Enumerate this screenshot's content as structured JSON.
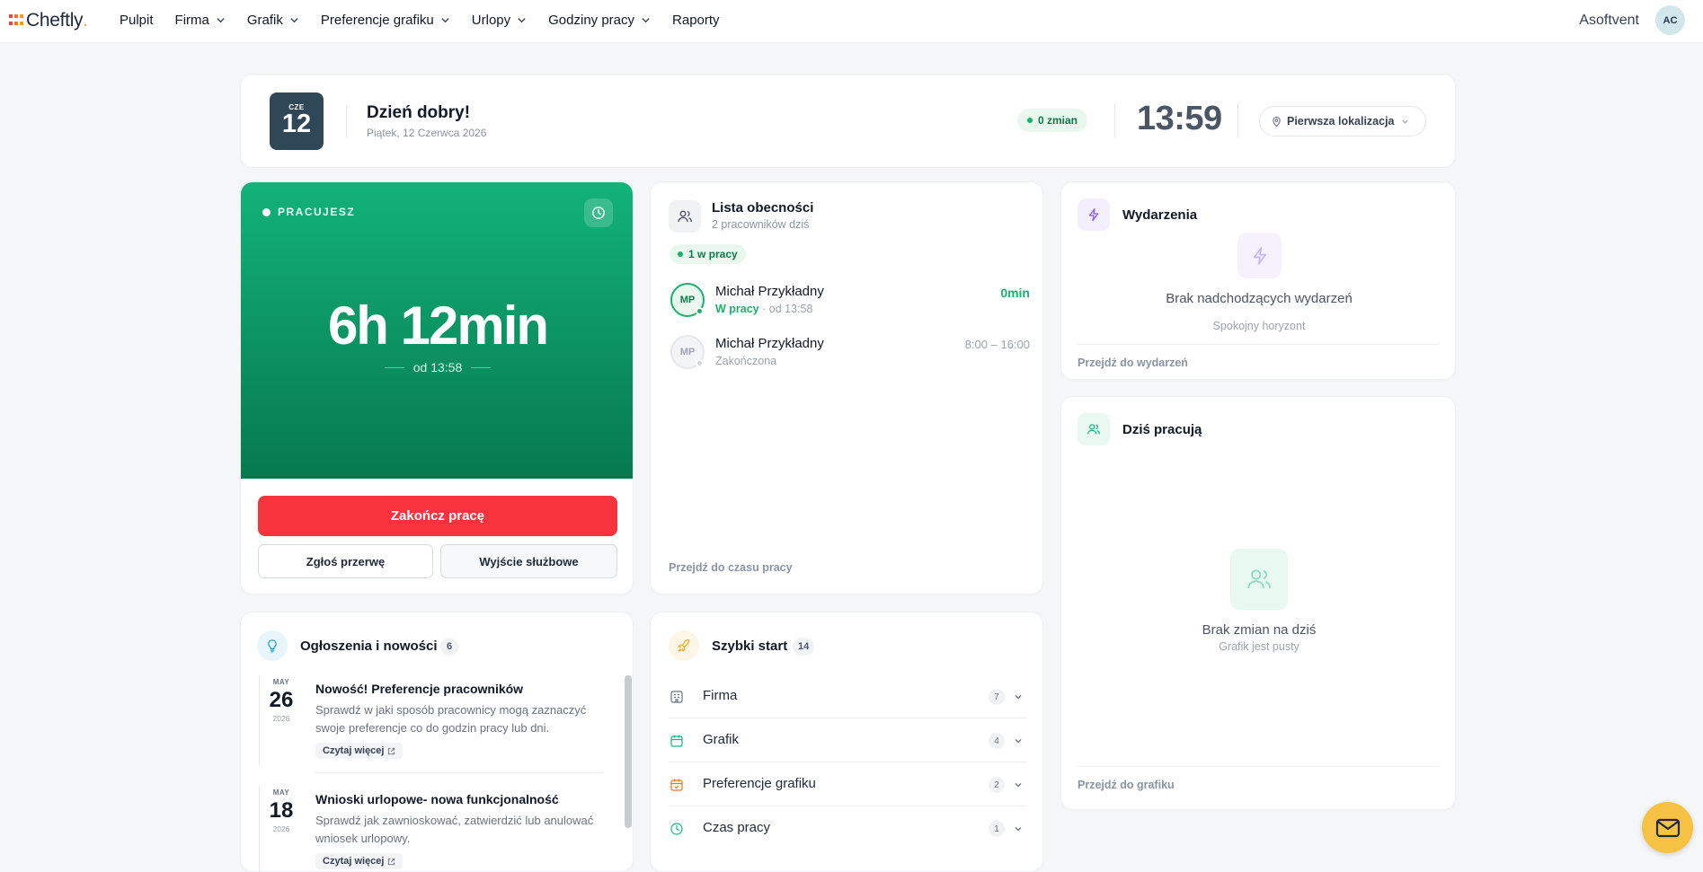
{
  "nav": {
    "logo_text": "Cheftly",
    "logo_dot": ".",
    "items": [
      {
        "label": "Pulpit",
        "has_dropdown": false
      },
      {
        "label": "Firma",
        "has_dropdown": true
      },
      {
        "label": "Grafik",
        "has_dropdown": true
      },
      {
        "label": "Preferencje grafiku",
        "has_dropdown": true
      },
      {
        "label": "Urlopy",
        "has_dropdown": true
      },
      {
        "label": "Godziny pracy",
        "has_dropdown": true
      },
      {
        "label": "Raporty",
        "has_dropdown": false
      }
    ],
    "company": "Asoftvent",
    "avatar_initials": "AC"
  },
  "greeting": {
    "day_abbr": "CZE",
    "day_number": "12",
    "title": "Dzień dobry!",
    "date_text": "Piątek, 12 Czerwca 2026",
    "shifts_pill": "0 zmian",
    "clock": "13:59",
    "location": "Pierwsza lokalizacja"
  },
  "timer": {
    "status": "PRACUJESZ",
    "duration": "6h 12min",
    "since": "od 13:58",
    "end_button": "Zakończ pracę",
    "break_button": "Zgłoś przerwę",
    "business_exit_button": "Wyjście służbowe"
  },
  "attendance": {
    "title": "Lista obecności",
    "subtitle": "2 pracowników dziś",
    "at_work_pill": "1 w pracy",
    "people": [
      {
        "initials": "MP",
        "name": "Michał Przykładny",
        "status": "W pracy",
        "status_extra": " · od 13:58",
        "right": "0min",
        "active": true
      },
      {
        "initials": "MP",
        "name": "Michał Przykładny",
        "status": "Zakończona",
        "status_extra": "",
        "right": "8:00 – 16:00",
        "active": false
      }
    ],
    "link": "Przejdź do czasu pracy"
  },
  "events": {
    "title": "Wydarzenia",
    "empty_title": "Brak nadchodzących wydarzeń",
    "empty_subtitle": "Spokojny horyzont",
    "link": "Przejdź do wydarzeń"
  },
  "today": {
    "title": "Dziś pracują",
    "empty_title": "Brak zmian na dziś",
    "empty_subtitle": "Grafik jest pusty",
    "link": "Przejdź do grafiku"
  },
  "news": {
    "title": "Ogłoszenia i nowości",
    "count": "6",
    "items": [
      {
        "month": "MAY",
        "day": "26",
        "year": "2026",
        "title": "Nowość! Preferencje pracowników",
        "text": "Sprawdź w jaki sposób pracownicy mogą zaznaczyć swoje preferencje co do godzin pracy lub dni.",
        "link": "Czytaj więcej"
      },
      {
        "month": "MAY",
        "day": "18",
        "year": "2026",
        "title": "Wnioski urlopowe- nowa funkcjonalność",
        "text": "Sprawdź jak zawnioskować, zatwierdzić lub anulować wniosek urlopowy.",
        "link": "Czytaj więcej"
      }
    ]
  },
  "quick_start": {
    "title": "Szybki start",
    "count": "14",
    "items": [
      {
        "label": "Firma",
        "count": "7",
        "icon": "building-icon",
        "color": "#6b7280"
      },
      {
        "label": "Grafik",
        "count": "4",
        "icon": "calendar-icon",
        "color": "#10b981"
      },
      {
        "label": "Preferencje grafiku",
        "count": "2",
        "icon": "calendar-check-icon",
        "color": "#f97316"
      },
      {
        "label": "Czas pracy",
        "count": "1",
        "icon": "clock-icon",
        "color": "#10b981"
      }
    ]
  },
  "colors": {
    "brand_green": "#0c9262",
    "danger_red": "#f7333b",
    "accent_yellow": "#f6c244",
    "date_badge": "#2f4756"
  }
}
